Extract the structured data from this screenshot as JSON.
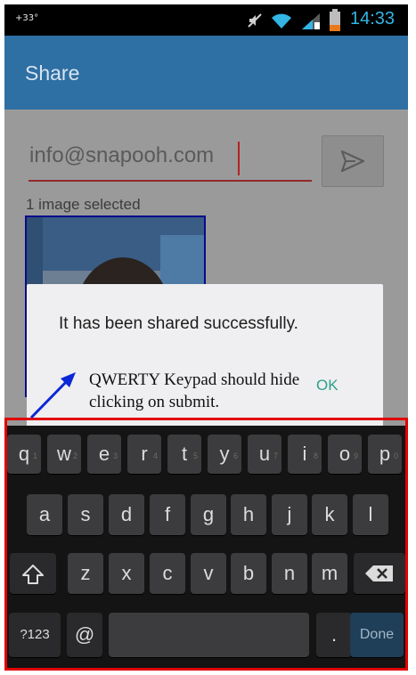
{
  "status_bar": {
    "temperature": "+33°",
    "time": "14:33"
  },
  "action_bar": {
    "title": "Share"
  },
  "form": {
    "email_value": "info@snapooh.com",
    "selection_count": "1 image selected"
  },
  "dialog": {
    "message": "It has been shared successfully.",
    "ok_label": "OK"
  },
  "annotation": {
    "note": "QWERTY Keypad should hide clicking on submit."
  },
  "keyboard": {
    "row1": [
      {
        "label": "q",
        "hint": "1"
      },
      {
        "label": "w",
        "hint": "2"
      },
      {
        "label": "e",
        "hint": "3"
      },
      {
        "label": "r",
        "hint": "4"
      },
      {
        "label": "t",
        "hint": "5"
      },
      {
        "label": "y",
        "hint": "6"
      },
      {
        "label": "u",
        "hint": "7"
      },
      {
        "label": "i",
        "hint": "8"
      },
      {
        "label": "o",
        "hint": "9"
      },
      {
        "label": "p",
        "hint": "0"
      }
    ],
    "row2": [
      "a",
      "s",
      "d",
      "f",
      "g",
      "h",
      "j",
      "k",
      "l"
    ],
    "row3": [
      "z",
      "x",
      "c",
      "v",
      "b",
      "n",
      "m"
    ],
    "symbols_label": "?123",
    "at_label": "@",
    "period_label": ".",
    "done_label": "Done"
  },
  "colors": {
    "action_bar": "#2e6fa4",
    "accent_time": "#33b5e5",
    "ok_text": "#2ca08c",
    "highlight_frame": "#e10000",
    "annotation_arrow": "#0b27d6"
  }
}
